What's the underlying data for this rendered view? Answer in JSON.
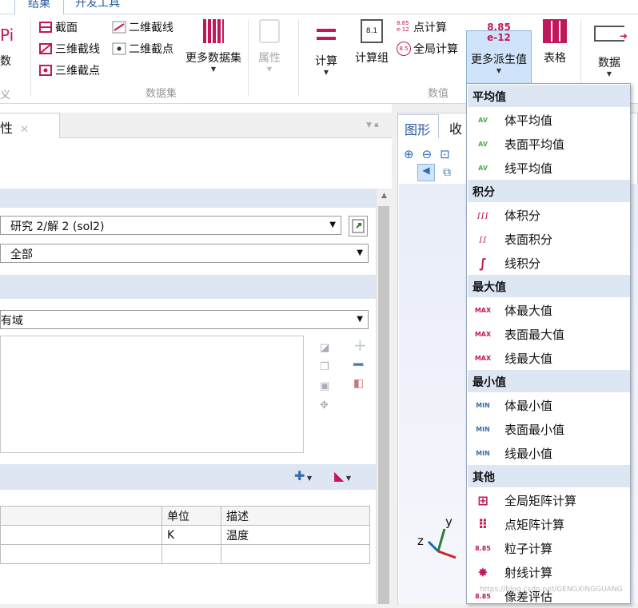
{
  "tabs": {
    "results": "结果",
    "developer": "开发工具"
  },
  "ribbon": {
    "partial_label": "数",
    "def_group_label": "义",
    "cutplane": "截面",
    "cutline2d": "二维截线",
    "cutline3d": "三维截线",
    "cutpoint2d": "二维截点",
    "cutpoint3d": "三维截点",
    "more_datasets": "更多数据集",
    "properties": "属性",
    "datasets_group": "数据集",
    "calc": "计算",
    "calc_group": "计算组",
    "point_eval": "点计算",
    "global_eval": "全局计算",
    "more_derived": "更多派生值",
    "table": "表格",
    "derived_group": "数值",
    "data": "数据",
    "derived_icon_top": "8.85",
    "derived_icon_bottom": "e-12"
  },
  "left": {
    "panel_tab": "性",
    "panel_tab_close": "✕",
    "dataset_value": "研究 2/解 2 (sol2)",
    "param_value": "全部",
    "selection_value": "有域",
    "table_headers": [
      "",
      "单位",
      "描述"
    ],
    "table_rows": [
      [
        "",
        "K",
        "温度"
      ],
      [
        "",
        "",
        ""
      ]
    ]
  },
  "graphics": {
    "tab": "图形",
    "tab2": "收",
    "axis_y": "y",
    "axis_z": "z"
  },
  "menu": {
    "sections": [
      {
        "header": "平均值",
        "items": [
          {
            "icon": "AV",
            "label": "体平均值"
          },
          {
            "icon": "AV",
            "label": "表面平均值"
          },
          {
            "icon": "AV",
            "label": "线平均值"
          }
        ]
      },
      {
        "header": "积分",
        "items": [
          {
            "icon": "∫∫∫",
            "label": "体积分"
          },
          {
            "icon": "∫∫",
            "label": "表面积分"
          },
          {
            "icon": "∫",
            "label": "线积分"
          }
        ]
      },
      {
        "header": "最大值",
        "items": [
          {
            "icon": "MAX",
            "label": "体最大值"
          },
          {
            "icon": "MAX",
            "label": "表面最大值"
          },
          {
            "icon": "MAX",
            "label": "线最大值"
          }
        ]
      },
      {
        "header": "最小值",
        "items": [
          {
            "icon": "MIN",
            "label": "体最小值"
          },
          {
            "icon": "MIN",
            "label": "表面最小值"
          },
          {
            "icon": "MIN",
            "label": "线最小值"
          }
        ]
      },
      {
        "header": "其他",
        "items": [
          {
            "icon": "⊞",
            "label": "全局矩阵计算"
          },
          {
            "icon": "⠿",
            "label": "点矩阵计算"
          },
          {
            "icon": "8.85",
            "label": "粒子计算"
          },
          {
            "icon": "✸",
            "label": "射线计算"
          },
          {
            "icon": "8.85",
            "label": "像差评估"
          }
        ]
      }
    ]
  },
  "watermark": "https://blog.csdn.net/GENGXINGGUANG",
  "colors": {
    "accent": "#c2185b",
    "av": "#4caf50",
    "minmax": "#c2185b",
    "min": "#3a6ea5",
    "highlight": "#cfe4fa"
  }
}
